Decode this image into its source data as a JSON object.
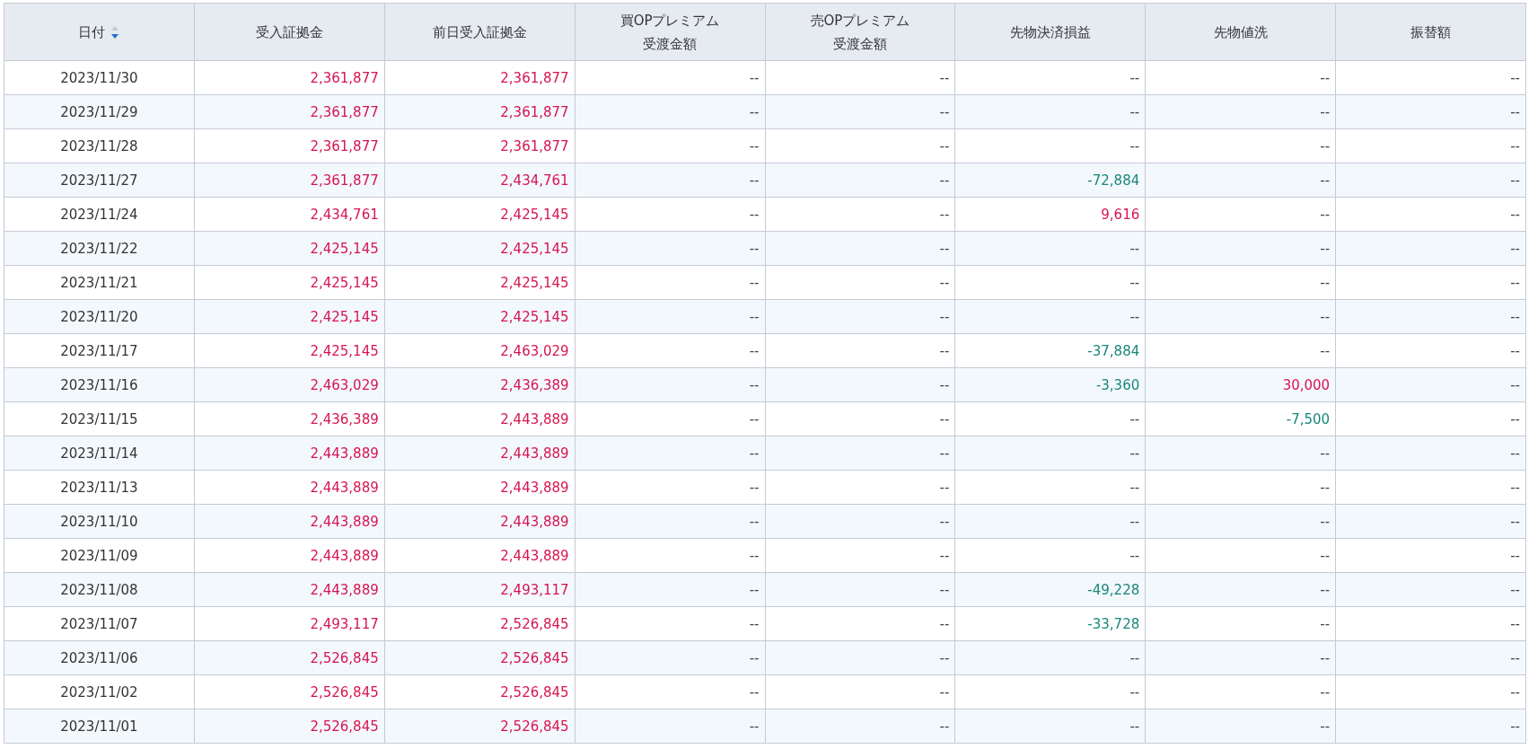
{
  "table": {
    "columns": [
      {
        "lines": [
          "日付"
        ],
        "sorted_descending": true
      },
      {
        "lines": [
          "受入証拠金"
        ]
      },
      {
        "lines": [
          "前日受入証拠金"
        ]
      },
      {
        "lines": [
          "買OPプレミアム",
          "受渡金額"
        ]
      },
      {
        "lines": [
          "売OPプレミアム",
          "受渡金額"
        ]
      },
      {
        "lines": [
          "先物決済損益"
        ]
      },
      {
        "lines": [
          "先物値洗"
        ]
      },
      {
        "lines": [
          "振替額"
        ]
      }
    ],
    "rows": [
      {
        "cells": [
          {
            "text": "2023/11/30",
            "kind": "date"
          },
          {
            "text": "2,361,877",
            "kind": "pos"
          },
          {
            "text": "2,361,877",
            "kind": "pos"
          },
          {
            "text": "--",
            "kind": "none"
          },
          {
            "text": "--",
            "kind": "none"
          },
          {
            "text": "--",
            "kind": "none"
          },
          {
            "text": "--",
            "kind": "none"
          },
          {
            "text": "--",
            "kind": "none"
          }
        ]
      },
      {
        "cells": [
          {
            "text": "2023/11/29",
            "kind": "date"
          },
          {
            "text": "2,361,877",
            "kind": "pos"
          },
          {
            "text": "2,361,877",
            "kind": "pos"
          },
          {
            "text": "--",
            "kind": "none"
          },
          {
            "text": "--",
            "kind": "none"
          },
          {
            "text": "--",
            "kind": "none"
          },
          {
            "text": "--",
            "kind": "none"
          },
          {
            "text": "--",
            "kind": "none"
          }
        ]
      },
      {
        "cells": [
          {
            "text": "2023/11/28",
            "kind": "date"
          },
          {
            "text": "2,361,877",
            "kind": "pos"
          },
          {
            "text": "2,361,877",
            "kind": "pos"
          },
          {
            "text": "--",
            "kind": "none"
          },
          {
            "text": "--",
            "kind": "none"
          },
          {
            "text": "--",
            "kind": "none"
          },
          {
            "text": "--",
            "kind": "none"
          },
          {
            "text": "--",
            "kind": "none"
          }
        ]
      },
      {
        "cells": [
          {
            "text": "2023/11/27",
            "kind": "date"
          },
          {
            "text": "2,361,877",
            "kind": "pos"
          },
          {
            "text": "2,434,761",
            "kind": "pos"
          },
          {
            "text": "--",
            "kind": "none"
          },
          {
            "text": "--",
            "kind": "none"
          },
          {
            "text": "-72,884",
            "kind": "neg"
          },
          {
            "text": "--",
            "kind": "none"
          },
          {
            "text": "--",
            "kind": "none"
          }
        ]
      },
      {
        "cells": [
          {
            "text": "2023/11/24",
            "kind": "date"
          },
          {
            "text": "2,434,761",
            "kind": "pos"
          },
          {
            "text": "2,425,145",
            "kind": "pos"
          },
          {
            "text": "--",
            "kind": "none"
          },
          {
            "text": "--",
            "kind": "none"
          },
          {
            "text": "9,616",
            "kind": "pos"
          },
          {
            "text": "--",
            "kind": "none"
          },
          {
            "text": "--",
            "kind": "none"
          }
        ]
      },
      {
        "cells": [
          {
            "text": "2023/11/22",
            "kind": "date"
          },
          {
            "text": "2,425,145",
            "kind": "pos"
          },
          {
            "text": "2,425,145",
            "kind": "pos"
          },
          {
            "text": "--",
            "kind": "none"
          },
          {
            "text": "--",
            "kind": "none"
          },
          {
            "text": "--",
            "kind": "none"
          },
          {
            "text": "--",
            "kind": "none"
          },
          {
            "text": "--",
            "kind": "none"
          }
        ]
      },
      {
        "cells": [
          {
            "text": "2023/11/21",
            "kind": "date"
          },
          {
            "text": "2,425,145",
            "kind": "pos"
          },
          {
            "text": "2,425,145",
            "kind": "pos"
          },
          {
            "text": "--",
            "kind": "none"
          },
          {
            "text": "--",
            "kind": "none"
          },
          {
            "text": "--",
            "kind": "none"
          },
          {
            "text": "--",
            "kind": "none"
          },
          {
            "text": "--",
            "kind": "none"
          }
        ]
      },
      {
        "cells": [
          {
            "text": "2023/11/20",
            "kind": "date"
          },
          {
            "text": "2,425,145",
            "kind": "pos"
          },
          {
            "text": "2,425,145",
            "kind": "pos"
          },
          {
            "text": "--",
            "kind": "none"
          },
          {
            "text": "--",
            "kind": "none"
          },
          {
            "text": "--",
            "kind": "none"
          },
          {
            "text": "--",
            "kind": "none"
          },
          {
            "text": "--",
            "kind": "none"
          }
        ]
      },
      {
        "cells": [
          {
            "text": "2023/11/17",
            "kind": "date"
          },
          {
            "text": "2,425,145",
            "kind": "pos"
          },
          {
            "text": "2,463,029",
            "kind": "pos"
          },
          {
            "text": "--",
            "kind": "none"
          },
          {
            "text": "--",
            "kind": "none"
          },
          {
            "text": "-37,884",
            "kind": "neg"
          },
          {
            "text": "--",
            "kind": "none"
          },
          {
            "text": "--",
            "kind": "none"
          }
        ]
      },
      {
        "cells": [
          {
            "text": "2023/11/16",
            "kind": "date"
          },
          {
            "text": "2,463,029",
            "kind": "pos"
          },
          {
            "text": "2,436,389",
            "kind": "pos"
          },
          {
            "text": "--",
            "kind": "none"
          },
          {
            "text": "--",
            "kind": "none"
          },
          {
            "text": "-3,360",
            "kind": "neg"
          },
          {
            "text": "30,000",
            "kind": "pos"
          },
          {
            "text": "--",
            "kind": "none"
          }
        ]
      },
      {
        "cells": [
          {
            "text": "2023/11/15",
            "kind": "date"
          },
          {
            "text": "2,436,389",
            "kind": "pos"
          },
          {
            "text": "2,443,889",
            "kind": "pos"
          },
          {
            "text": "--",
            "kind": "none"
          },
          {
            "text": "--",
            "kind": "none"
          },
          {
            "text": "--",
            "kind": "none"
          },
          {
            "text": "-7,500",
            "kind": "neg"
          },
          {
            "text": "--",
            "kind": "none"
          }
        ]
      },
      {
        "cells": [
          {
            "text": "2023/11/14",
            "kind": "date"
          },
          {
            "text": "2,443,889",
            "kind": "pos"
          },
          {
            "text": "2,443,889",
            "kind": "pos"
          },
          {
            "text": "--",
            "kind": "none"
          },
          {
            "text": "--",
            "kind": "none"
          },
          {
            "text": "--",
            "kind": "none"
          },
          {
            "text": "--",
            "kind": "none"
          },
          {
            "text": "--",
            "kind": "none"
          }
        ]
      },
      {
        "cells": [
          {
            "text": "2023/11/13",
            "kind": "date"
          },
          {
            "text": "2,443,889",
            "kind": "pos"
          },
          {
            "text": "2,443,889",
            "kind": "pos"
          },
          {
            "text": "--",
            "kind": "none"
          },
          {
            "text": "--",
            "kind": "none"
          },
          {
            "text": "--",
            "kind": "none"
          },
          {
            "text": "--",
            "kind": "none"
          },
          {
            "text": "--",
            "kind": "none"
          }
        ]
      },
      {
        "cells": [
          {
            "text": "2023/11/10",
            "kind": "date"
          },
          {
            "text": "2,443,889",
            "kind": "pos"
          },
          {
            "text": "2,443,889",
            "kind": "pos"
          },
          {
            "text": "--",
            "kind": "none"
          },
          {
            "text": "--",
            "kind": "none"
          },
          {
            "text": "--",
            "kind": "none"
          },
          {
            "text": "--",
            "kind": "none"
          },
          {
            "text": "--",
            "kind": "none"
          }
        ]
      },
      {
        "cells": [
          {
            "text": "2023/11/09",
            "kind": "date"
          },
          {
            "text": "2,443,889",
            "kind": "pos"
          },
          {
            "text": "2,443,889",
            "kind": "pos"
          },
          {
            "text": "--",
            "kind": "none"
          },
          {
            "text": "--",
            "kind": "none"
          },
          {
            "text": "--",
            "kind": "none"
          },
          {
            "text": "--",
            "kind": "none"
          },
          {
            "text": "--",
            "kind": "none"
          }
        ]
      },
      {
        "cells": [
          {
            "text": "2023/11/08",
            "kind": "date"
          },
          {
            "text": "2,443,889",
            "kind": "pos"
          },
          {
            "text": "2,493,117",
            "kind": "pos"
          },
          {
            "text": "--",
            "kind": "none"
          },
          {
            "text": "--",
            "kind": "none"
          },
          {
            "text": "-49,228",
            "kind": "neg"
          },
          {
            "text": "--",
            "kind": "none"
          },
          {
            "text": "--",
            "kind": "none"
          }
        ]
      },
      {
        "cells": [
          {
            "text": "2023/11/07",
            "kind": "date"
          },
          {
            "text": "2,493,117",
            "kind": "pos"
          },
          {
            "text": "2,526,845",
            "kind": "pos"
          },
          {
            "text": "--",
            "kind": "none"
          },
          {
            "text": "--",
            "kind": "none"
          },
          {
            "text": "-33,728",
            "kind": "neg"
          },
          {
            "text": "--",
            "kind": "none"
          },
          {
            "text": "--",
            "kind": "none"
          }
        ]
      },
      {
        "cells": [
          {
            "text": "2023/11/06",
            "kind": "date"
          },
          {
            "text": "2,526,845",
            "kind": "pos"
          },
          {
            "text": "2,526,845",
            "kind": "pos"
          },
          {
            "text": "--",
            "kind": "none"
          },
          {
            "text": "--",
            "kind": "none"
          },
          {
            "text": "--",
            "kind": "none"
          },
          {
            "text": "--",
            "kind": "none"
          },
          {
            "text": "--",
            "kind": "none"
          }
        ]
      },
      {
        "cells": [
          {
            "text": "2023/11/02",
            "kind": "date"
          },
          {
            "text": "2,526,845",
            "kind": "pos"
          },
          {
            "text": "2,526,845",
            "kind": "pos"
          },
          {
            "text": "--",
            "kind": "none"
          },
          {
            "text": "--",
            "kind": "none"
          },
          {
            "text": "--",
            "kind": "none"
          },
          {
            "text": "--",
            "kind": "none"
          },
          {
            "text": "--",
            "kind": "none"
          }
        ]
      },
      {
        "cells": [
          {
            "text": "2023/11/01",
            "kind": "date"
          },
          {
            "text": "2,526,845",
            "kind": "pos"
          },
          {
            "text": "2,526,845",
            "kind": "pos"
          },
          {
            "text": "--",
            "kind": "none"
          },
          {
            "text": "--",
            "kind": "none"
          },
          {
            "text": "--",
            "kind": "none"
          },
          {
            "text": "--",
            "kind": "none"
          },
          {
            "text": "--",
            "kind": "none"
          }
        ]
      }
    ]
  }
}
